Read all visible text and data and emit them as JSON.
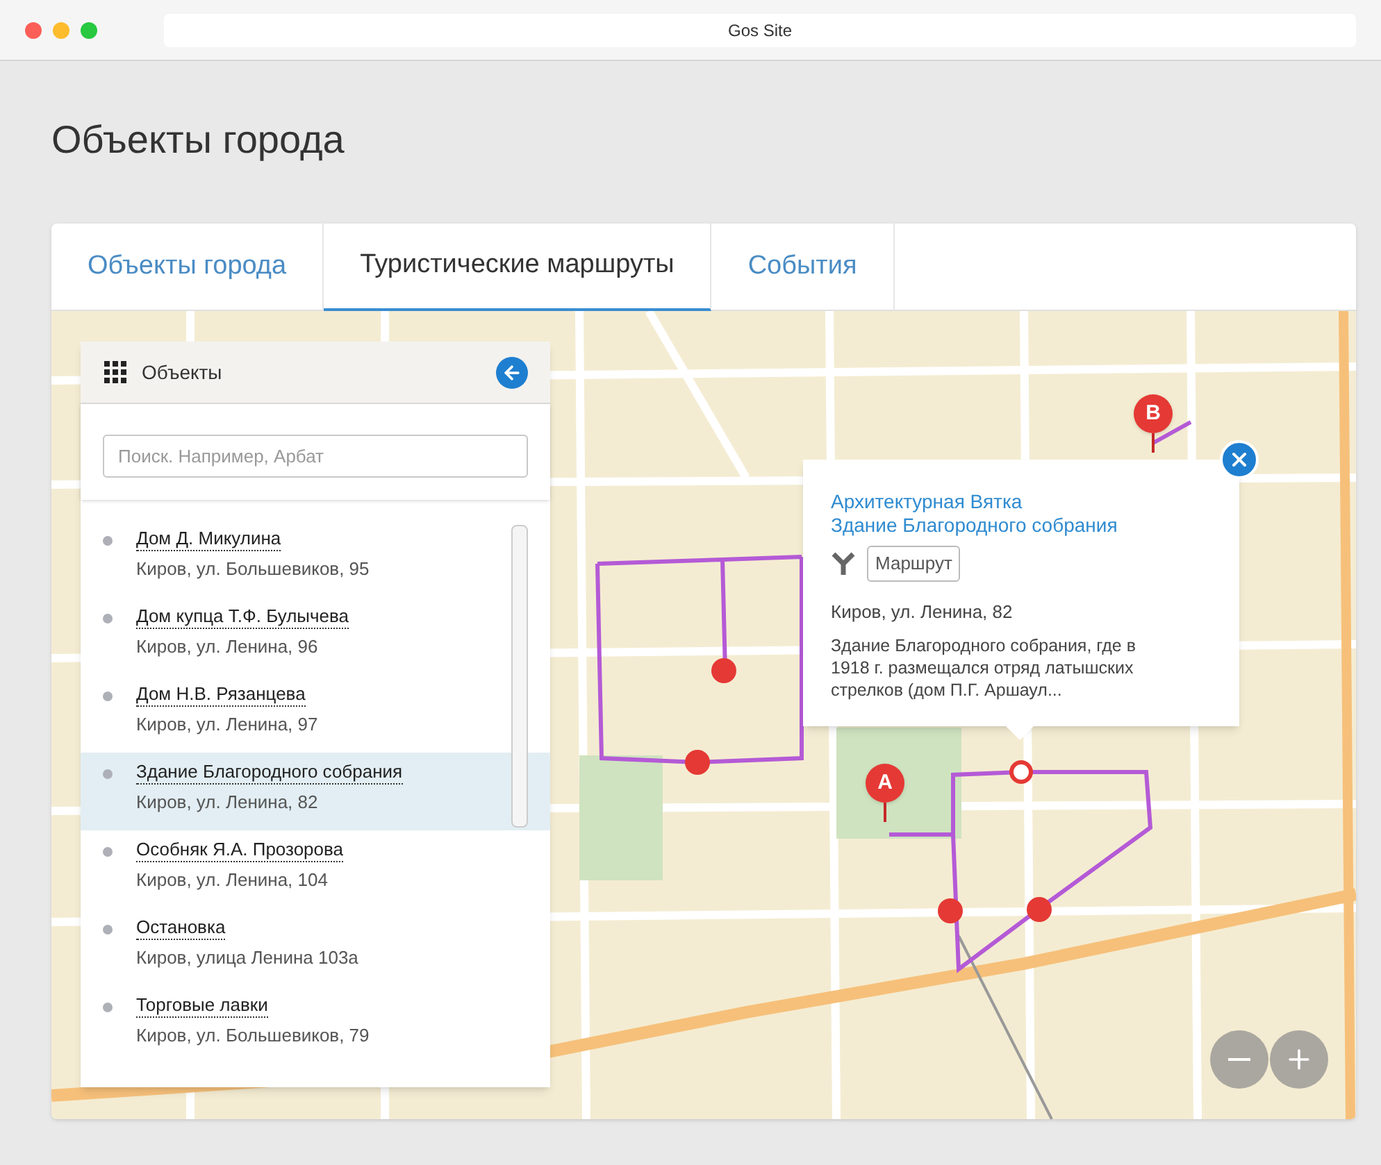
{
  "window": {
    "title": "Gos Site"
  },
  "page_title": "Объекты города",
  "tabs": [
    {
      "label": "Объекты города",
      "selected": false
    },
    {
      "label": "Туристические маршруты",
      "selected": true
    },
    {
      "label": "События",
      "selected": false
    }
  ],
  "panel": {
    "title": "Объекты",
    "search": {
      "placeholder": "Поиск. Например, Арбат"
    },
    "items": [
      {
        "name": "Дом Д. Микулина",
        "address": "Киров, ул. Большевиков, 95",
        "selected": false
      },
      {
        "name": "Дом купца Т.Ф. Булычева",
        "address": "Киров, ул. Ленина, 96",
        "selected": false
      },
      {
        "name": "Дом Н.В. Рязанцева",
        "address": "Киров, ул. Ленина, 97",
        "selected": false
      },
      {
        "name": "Здание Благородного собрания",
        "address": "Киров, ул. Ленина, 82",
        "selected": true
      },
      {
        "name": "Особняк Я.А. Прозорова",
        "address": "Киров, ул. Ленина, 104",
        "selected": false
      },
      {
        "name": "Остановка",
        "address": "Киров, улица Ленина 103а",
        "selected": false
      },
      {
        "name": "Торговые лавки",
        "address": "Киров, ул. Большевиков, 79",
        "selected": false
      }
    ]
  },
  "popup": {
    "title_lines": [
      "Архитектурная Вятка",
      "Здание Благородного собрания"
    ],
    "route_button": "Маршрут",
    "address": "Киров, ул. Ленина, 82",
    "description": "Здание Благородного собрания, где в 1918 г. размещался отряд латышских стрелков (дом П.Г. Аршаул..."
  },
  "map": {
    "markers": [
      {
        "label": "A"
      },
      {
        "label": "B"
      }
    ]
  }
}
